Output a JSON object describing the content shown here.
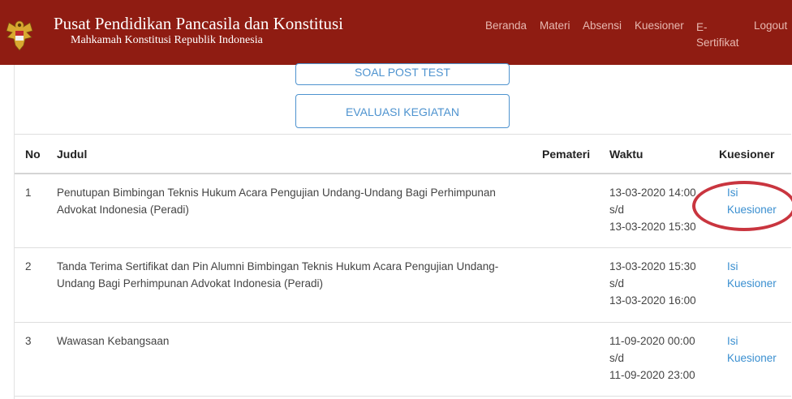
{
  "header": {
    "title": "Pusat Pendidikan Pancasila dan Konstitusi",
    "subtitle": "Mahkamah Konstitusi Republik Indonesia",
    "brand_color": "#8f1c12"
  },
  "nav": {
    "beranda": "Beranda",
    "materi": "Materi",
    "absensi": "Absensi",
    "kuesioner": "Kuesioner",
    "esertifikat_line1": "E-",
    "esertifikat_line2": "Sertifikat",
    "logout": "Logout"
  },
  "buttons": {
    "post_test": "SOAL POST TEST",
    "evaluasi": "EVALUASI KEGIATAN"
  },
  "table": {
    "headers": {
      "no": "No",
      "judul": "Judul",
      "pemateri": "Pemateri",
      "waktu": "Waktu",
      "kuesioner": "Kuesioner"
    },
    "rows": [
      {
        "no": "1",
        "judul_line1": "Penutupan Bimbingan Teknis Hukum Acara Pengujian Undang-Undang Bagi Perhimpunan",
        "judul_line2": "Advokat Indonesia (Peradi)",
        "pemateri": "",
        "waktu_start": "13-03-2020 14:00",
        "waktu_sep": "s/d",
        "waktu_end": "13-03-2020 15:30",
        "link_line1": "Isi",
        "link_line2": "Kuesioner"
      },
      {
        "no": "2",
        "judul_line1": "Tanda Terima Sertifikat dan Pin Alumni Bimbingan Teknis Hukum Acara Pengujian Undang-",
        "judul_line2": "Undang Bagi Perhimpunan Advokat Indonesia (Peradi)",
        "pemateri": "",
        "waktu_start": "13-03-2020 15:30",
        "waktu_sep": "s/d",
        "waktu_end": "13-03-2020 16:00",
        "link_line1": "Isi",
        "link_line2": "Kuesioner"
      },
      {
        "no": "3",
        "judul_line1": "Wawasan Kebangsaan",
        "judul_line2": "",
        "pemateri": "",
        "waktu_start": "11-09-2020 00:00",
        "waktu_sep": "s/d",
        "waktu_end": "11-09-2020 23:00",
        "link_line1": "Isi",
        "link_line2": "Kuesioner"
      }
    ]
  },
  "annotation_color": "#c9353f",
  "link_color": "#3a8fd0"
}
